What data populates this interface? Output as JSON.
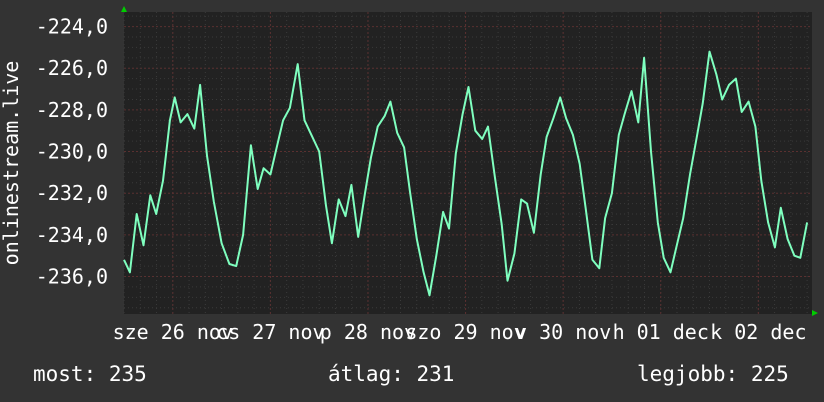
{
  "chart_data": {
    "type": "line",
    "ylabel": "onlinestream.live",
    "y_ticks": [
      "-224,0",
      "-226,0",
      "-228,0",
      "-230,0",
      "-232,0",
      "-234,0",
      "-236,0"
    ],
    "y_tick_values": [
      -224,
      -226,
      -228,
      -230,
      -232,
      -234,
      -236
    ],
    "ylim": [
      -237.8,
      -223.3
    ],
    "x_tick_labels": [
      "sze 26 nov",
      "cs 27 nov",
      "p 28 nov",
      "szo 29 nov",
      "v 30 nov",
      "h 01 dec",
      "k 02 dec"
    ],
    "x_tick_positions": [
      0.5,
      1.5,
      2.5,
      3.5,
      4.5,
      5.5,
      6.5
    ],
    "xlim": [
      0,
      7.05
    ],
    "grid": true,
    "colors": {
      "line": "#7fffbf",
      "plot_bg": "#222222",
      "grid": "#3a3a3a",
      "axis_arrow": "#00cc00"
    },
    "series": [
      {
        "x": [
          0.0,
          0.06,
          0.13,
          0.2,
          0.27,
          0.33,
          0.4,
          0.47,
          0.52,
          0.58,
          0.65,
          0.72,
          0.78,
          0.85,
          0.92,
          1.0,
          1.08,
          1.15,
          1.22,
          1.3,
          1.37,
          1.43,
          1.5,
          1.57,
          1.63,
          1.7,
          1.78,
          1.85,
          1.92,
          2.0,
          2.07,
          2.13,
          2.2,
          2.27,
          2.33,
          2.4,
          2.47,
          2.53,
          2.6,
          2.67,
          2.73,
          2.8,
          2.87,
          2.93,
          3.0,
          3.07,
          3.13,
          3.2,
          3.27,
          3.33,
          3.4,
          3.47,
          3.53,
          3.6,
          3.67,
          3.73,
          3.8,
          3.87,
          3.93,
          4.0,
          4.07,
          4.13,
          4.2,
          4.27,
          4.33,
          4.4,
          4.47,
          4.53,
          4.6,
          4.67,
          4.73,
          4.8,
          4.87,
          4.93,
          5.0,
          5.07,
          5.13,
          5.2,
          5.27,
          5.33,
          5.4,
          5.47,
          5.53,
          5.6,
          5.67,
          5.73,
          5.8,
          5.87,
          5.93,
          6.0,
          6.07,
          6.13,
          6.2,
          6.27,
          6.33,
          6.4,
          6.47,
          6.53,
          6.6,
          6.67,
          6.73,
          6.8,
          6.87,
          6.93,
          7.0
        ],
        "y": [
          -235.2,
          -235.8,
          -233.0,
          -234.5,
          -232.1,
          -233.0,
          -231.4,
          -228.5,
          -227.4,
          -228.6,
          -228.2,
          -228.9,
          -226.8,
          -230.2,
          -232.4,
          -234.4,
          -235.4,
          -235.5,
          -234.0,
          -229.7,
          -231.8,
          -230.8,
          -231.1,
          -229.7,
          -228.5,
          -227.9,
          -225.8,
          -228.5,
          -229.2,
          -230.0,
          -232.6,
          -234.4,
          -232.3,
          -233.1,
          -231.6,
          -234.1,
          -232.0,
          -230.3,
          -228.8,
          -228.3,
          -227.6,
          -229.1,
          -229.8,
          -231.9,
          -234.2,
          -235.8,
          -236.9,
          -235.0,
          -232.9,
          -233.7,
          -230.1,
          -228.2,
          -226.9,
          -229.0,
          -229.4,
          -228.8,
          -231.2,
          -233.5,
          -236.2,
          -234.9,
          -232.3,
          -232.5,
          -233.9,
          -231.1,
          -229.3,
          -228.4,
          -227.4,
          -228.4,
          -229.2,
          -230.6,
          -232.7,
          -235.2,
          -235.6,
          -233.2,
          -232.0,
          -229.2,
          -228.2,
          -227.1,
          -228.6,
          -225.5,
          -230.0,
          -233.4,
          -235.1,
          -235.8,
          -234.4,
          -233.2,
          -231.1,
          -229.3,
          -227.7,
          -225.2,
          -226.3,
          -227.5,
          -226.8,
          -226.5,
          -228.1,
          -227.6,
          -228.8,
          -231.4,
          -233.4,
          -234.6,
          -232.7,
          -234.2,
          -235.0,
          -235.1,
          -233.4
        ]
      }
    ]
  },
  "stats": {
    "now_label": "most:",
    "now_value": "235",
    "avg_label": "átlag:",
    "avg_value": "231",
    "best_label": "legjobb:",
    "best_value": "225"
  }
}
